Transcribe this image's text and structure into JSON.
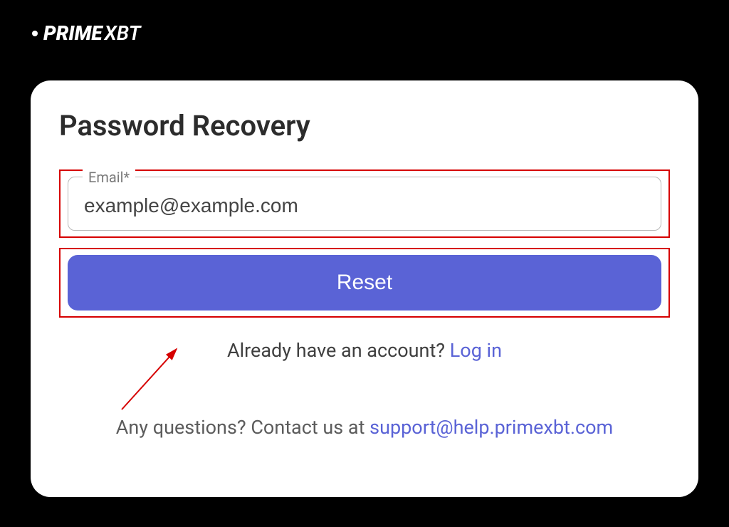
{
  "logo": {
    "prime": "PRIME",
    "xbt": "XBT"
  },
  "card": {
    "title": "Password Recovery",
    "email_label": "Email*",
    "email_value": "example@example.com",
    "reset_label": "Reset",
    "login_prompt": "Already have an account? ",
    "login_link": "Log in",
    "questions_prompt": "Any questions? Contact us at ",
    "support_email": "support@help.primexbt.com"
  }
}
